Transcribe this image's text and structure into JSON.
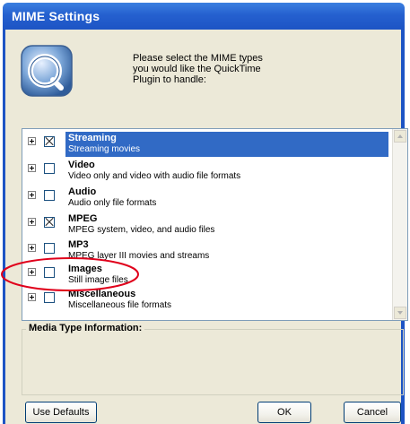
{
  "window": {
    "title": "MIME Settings"
  },
  "instruction_text": "Please select the MIME types you would like the QuickTime Plugin to handle:",
  "mime_list": {
    "items": [
      {
        "name": "Streaming",
        "description": "Streaming movies",
        "checked": true,
        "selected": true
      },
      {
        "name": "Video",
        "description": "Video only and video with audio file formats",
        "checked": false,
        "selected": false
      },
      {
        "name": "Audio",
        "description": "Audio only file formats",
        "checked": false,
        "selected": false
      },
      {
        "name": "MPEG",
        "description": "MPEG system, video, and audio files",
        "checked": true,
        "selected": false
      },
      {
        "name": "MP3",
        "description": "MPEG layer III movies and streams",
        "checked": false,
        "selected": false
      },
      {
        "name": "Images",
        "description": "Still image files",
        "checked": false,
        "selected": false
      },
      {
        "name": "Miscellaneous",
        "description": "Miscellaneous file formats",
        "checked": false,
        "selected": false
      }
    ]
  },
  "media_info": {
    "label": "Media Type Information:"
  },
  "buttons": {
    "use_defaults": "Use Defaults",
    "ok": "OK",
    "cancel": "Cancel"
  },
  "colors": {
    "title_bar": "#2560cf",
    "selection": "#316ac5",
    "dialog_face": "#ece9d8",
    "annotation": "#e0001b"
  },
  "icons": {
    "app_logo": "quicktime-logo-icon"
  }
}
